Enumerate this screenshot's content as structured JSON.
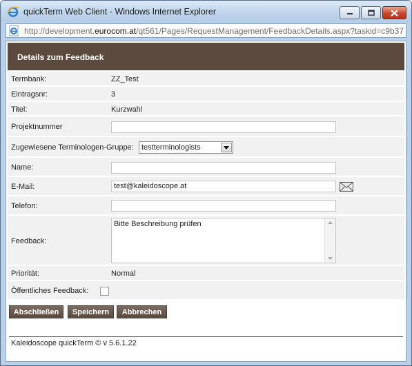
{
  "window": {
    "title": "quickTerm Web Client - Windows Internet Explorer",
    "url_prefix": "http://development.",
    "url_domain": "eurocom.at",
    "url_suffix": "/qt561/Pages/RequestManagement/FeedbackDetails.aspx?taskid=c9b37"
  },
  "header": {
    "title": "Details zum Feedback"
  },
  "fields": {
    "termbank": {
      "label": "Termbank:",
      "value": "ZZ_Test"
    },
    "eintragsnr": {
      "label": "Eintragsnr:",
      "value": "3"
    },
    "titel": {
      "label": "Titel:",
      "value": "Kurzwahl"
    },
    "projektnummer": {
      "label": "Projektnummer",
      "value": ""
    },
    "gruppe": {
      "label": "Zugewiesene Terminologen-Gruppe:",
      "selected": "testterminologists"
    },
    "name": {
      "label": "Name:",
      "value": ""
    },
    "email": {
      "label": "E-Mail:",
      "value": "test@kaleidoscope.at"
    },
    "telefon": {
      "label": "Telefon:",
      "value": ""
    },
    "feedback": {
      "label": "Feedback:",
      "value": "Bitte Beschreibung prüfen"
    },
    "prioritaet": {
      "label": "Priorität:",
      "value": "Normal"
    },
    "oeffentlich": {
      "label": "Öffentliches Feedback:",
      "checked": false
    }
  },
  "buttons": {
    "abschliessen": "Abschließen",
    "speichern": "Speichern",
    "abbrechen": "Abbrechen"
  },
  "footer": {
    "text": "Kaleidoscope quickTerm © v 5.6.1.22"
  },
  "colors": {
    "header_bg": "#5c4a3e",
    "button_bg": "#6a5a4f",
    "row_bg": "#f1f1f1"
  },
  "icons": {
    "browser": "ie-logo-icon",
    "page": "ie-page-icon",
    "mail": "envelope-icon"
  }
}
